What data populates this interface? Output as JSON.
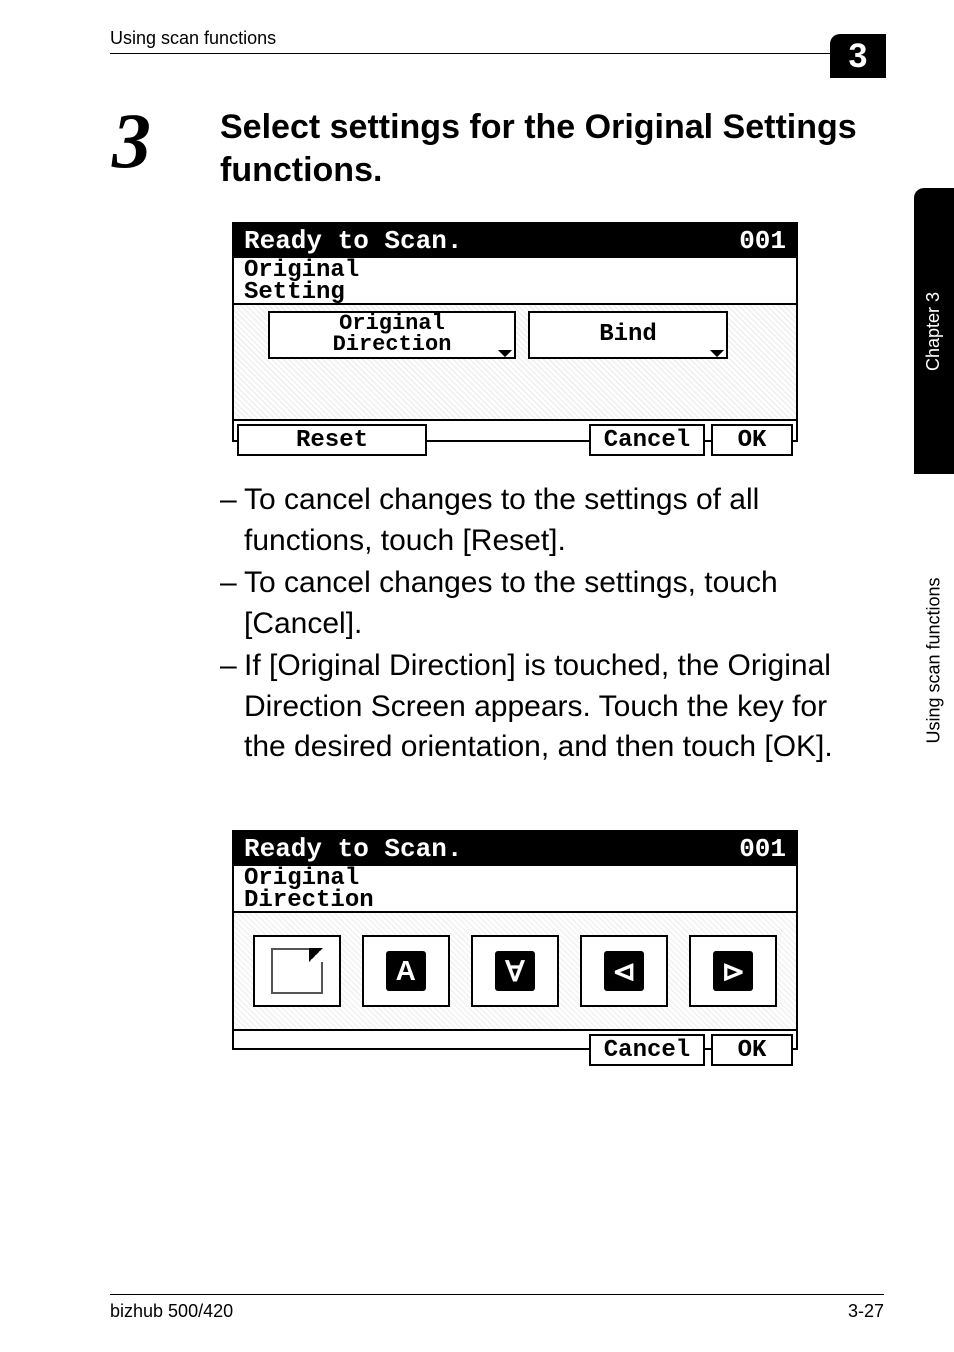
{
  "header": {
    "breadcrumb": "Using scan functions",
    "chapter_badge": "3"
  },
  "side": {
    "tab_top": "Chapter 3",
    "tab_bottom": "Using scan functions"
  },
  "step": {
    "number": "3",
    "title": "Select settings for the Original Settings functions."
  },
  "panel1": {
    "title_left": "Ready to Scan.",
    "title_right": "001",
    "subtitle_line1": "Original",
    "subtitle_line2": "Setting",
    "btn_origdir_line1": "Original",
    "btn_origdir_line2": "Direction",
    "btn_bind": "Bind",
    "reset": "Reset",
    "cancel": "Cancel",
    "ok": "OK"
  },
  "bullets": {
    "a": "To cancel changes to the settings of all functions, touch [Reset].",
    "b": "To cancel changes to the settings, touch [Cancel].",
    "c": "If [Original Direction] is touched, the Original Direction Screen appears. Touch the key for the desired orientation, and then touch [OK]."
  },
  "panel2": {
    "title_left": "Ready to Scan.",
    "title_right": "001",
    "subtitle_line1": "Original",
    "subtitle_line2": "Direction",
    "cancel": "Cancel",
    "ok": "OK",
    "icons": {
      "b": "A",
      "c": "∀",
      "d": "⊲",
      "e": "⊳"
    }
  },
  "footer": {
    "left": "bizhub 500/420",
    "right": "3-27"
  }
}
